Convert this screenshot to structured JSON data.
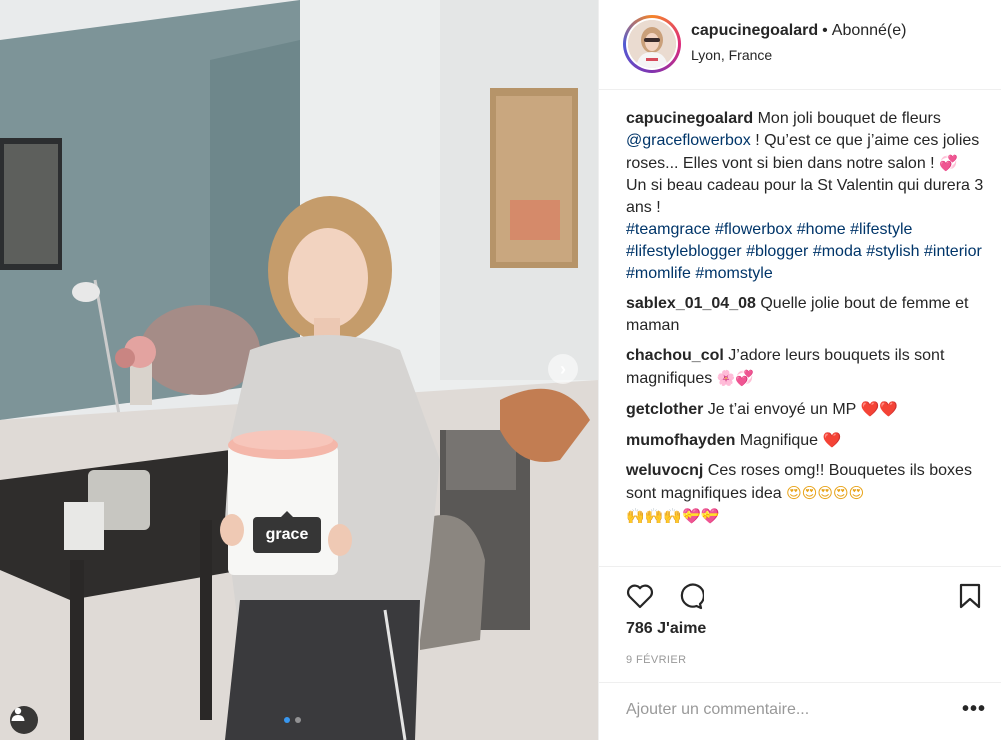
{
  "post": {
    "username": "capucinegoalard",
    "separator": "•",
    "follow_status": "Abonné(e)",
    "location": "Lyon, France",
    "photo_tag": "grace"
  },
  "caption": {
    "username": "capucinegoalard",
    "text_1": " Mon joli bouquet de fleurs ",
    "mention": "@graceflowerbox",
    "text_2": " ! Qu’est ce que j’aime ces jolies roses... Elles vont si bien dans notre salon ! ",
    "emoji_1": "💞",
    "text_3": "Un si beau cadeau pour la St Valentin qui durera 3 ans !",
    "hashtags": [
      "#teamgrace",
      "#flowerbox",
      "#home",
      "#lifestyle",
      "#lifestyleblogger",
      "#blogger",
      "#moda",
      "#stylish",
      "#interior",
      "#momlife",
      "#momstyle"
    ]
  },
  "comments": [
    {
      "user": "sablex_01_04_08",
      "text": " Quelle jolie bout de femme et maman",
      "emoji": ""
    },
    {
      "user": "chachou_col",
      "text": " J’adore leurs bouquets ils sont magnifiques ",
      "emoji": "🌸💞"
    },
    {
      "user": "getclother",
      "text": " Je t’ai envoyé un MP ",
      "emoji": "❤️❤️"
    },
    {
      "user": "mumofhayden",
      "text": " Magnifique ",
      "emoji": "❤️"
    },
    {
      "user": "weluvocnj",
      "text": " Ces roses omg!! Bouquetes ils boxes sont magnifiques idea ",
      "emoji": "😍😍😍😍😍",
      "emoji_2": "🙌🙌🙌💝💝"
    }
  ],
  "actions": {
    "like_icon": "heart-outline-icon",
    "comment_icon": "comment-bubble-icon",
    "save_icon": "bookmark-icon"
  },
  "likes": "786 J'aime",
  "date": "9 FÉVRIER",
  "comment_placeholder": "Ajouter un commentaire...",
  "more_label": "•••",
  "colors": {
    "link": "#003569",
    "heart": "#ed4956",
    "carousel_active": "#3897f0"
  }
}
